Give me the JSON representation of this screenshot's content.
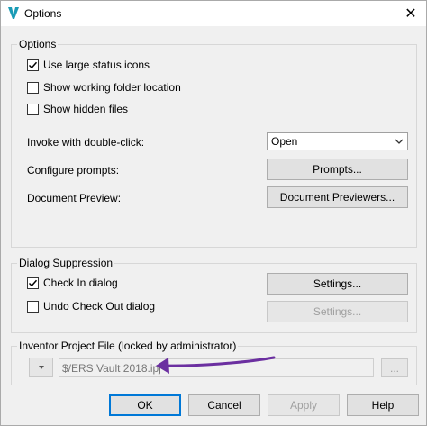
{
  "window": {
    "title": "Options",
    "close_glyph": "✕"
  },
  "options_group": {
    "legend": "Options",
    "checkboxes": [
      {
        "label": "Use large status icons",
        "checked": true
      },
      {
        "label": "Show working folder location",
        "checked": false
      },
      {
        "label": "Show hidden files",
        "checked": false
      }
    ],
    "invoke_label": "Invoke with double-click:",
    "invoke_value": "Open",
    "configure_label": "Configure prompts:",
    "prompts_button": "Prompts...",
    "preview_label": "Document Preview:",
    "previewers_button": "Document Previewers..."
  },
  "suppression_group": {
    "legend": "Dialog Suppression",
    "checkboxes": [
      {
        "label": "Check In dialog",
        "checked": true
      },
      {
        "label": "Undo Check Out dialog",
        "checked": false
      }
    ],
    "settings_button": "Settings...",
    "settings_button_disabled": "Settings..."
  },
  "project_group": {
    "legend": "Inventor Project File (locked by administrator)",
    "path_value": "$/ERS Vault 2018.ipj",
    "browse_button": "..."
  },
  "footer": {
    "ok": "OK",
    "cancel": "Cancel",
    "apply": "Apply",
    "help": "Help"
  },
  "colors": {
    "annotation_arrow": "#6b2fa0",
    "focus_border": "#0078d7",
    "app_icon": "#1a9bb5"
  },
  "icons": {
    "app": "autodesk-vault-v-icon",
    "close": "close-icon",
    "check": "check-icon",
    "dropdown": "chevron-down-icon"
  }
}
